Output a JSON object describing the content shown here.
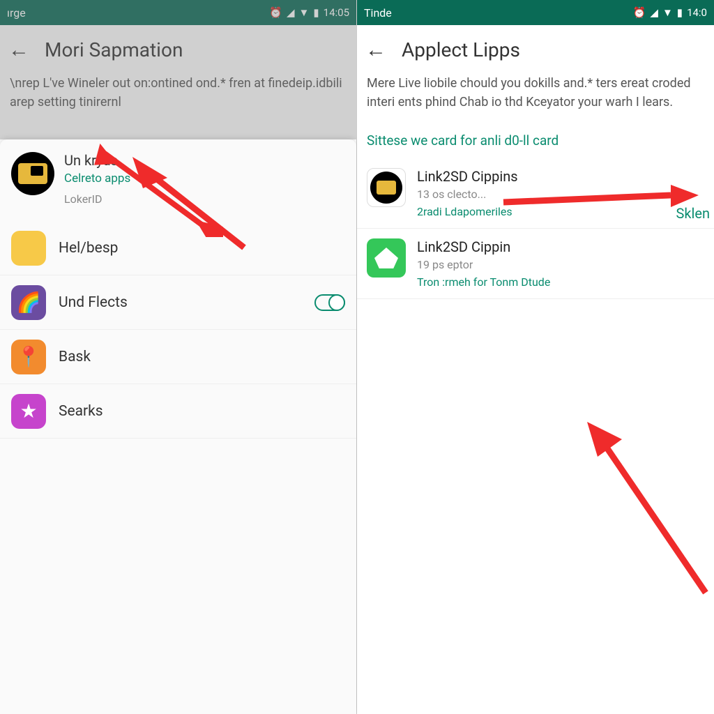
{
  "left": {
    "status": {
      "carrier": "ırge",
      "time": "14:05"
    },
    "title": "Mori Sapmation",
    "desc": "\\nrep L've Wineler out on:ontined ond.* fren at finedeip.idbili arep setting tinirernl",
    "sheet": {
      "name": "Un kryds",
      "sub": "Celreto apps",
      "meta": "LokerID"
    },
    "items": [
      {
        "label": "Hel/besp",
        "icon": "apple",
        "toggle": false
      },
      {
        "label": "Und Flects",
        "icon": "rainbow",
        "toggle": true
      },
      {
        "label": "Bask",
        "icon": "pin",
        "toggle": false
      },
      {
        "label": "Searks",
        "icon": "star",
        "toggle": false
      }
    ]
  },
  "right": {
    "status": {
      "carrier": "Tinde",
      "time": "14:0"
    },
    "title": "Applect Lipps",
    "desc": "Mere Live liobile chould you dokills and.* ters ereat croded interi ents phind Chab io thd Kceyator your warh I lears.",
    "sidelabel": "Sklen",
    "section": "Sittese we card for anli d0-ll card",
    "apps": [
      {
        "name": "Link2SD Cippins",
        "sub": "13 os clecto...",
        "link": "2radi Ldapomeriles",
        "icon": "dark"
      },
      {
        "name": "Link2SD Cippin",
        "sub": "19 ps eptor",
        "link": "Tron :rmeh for Tonm Dtude",
        "icon": "green"
      }
    ]
  }
}
